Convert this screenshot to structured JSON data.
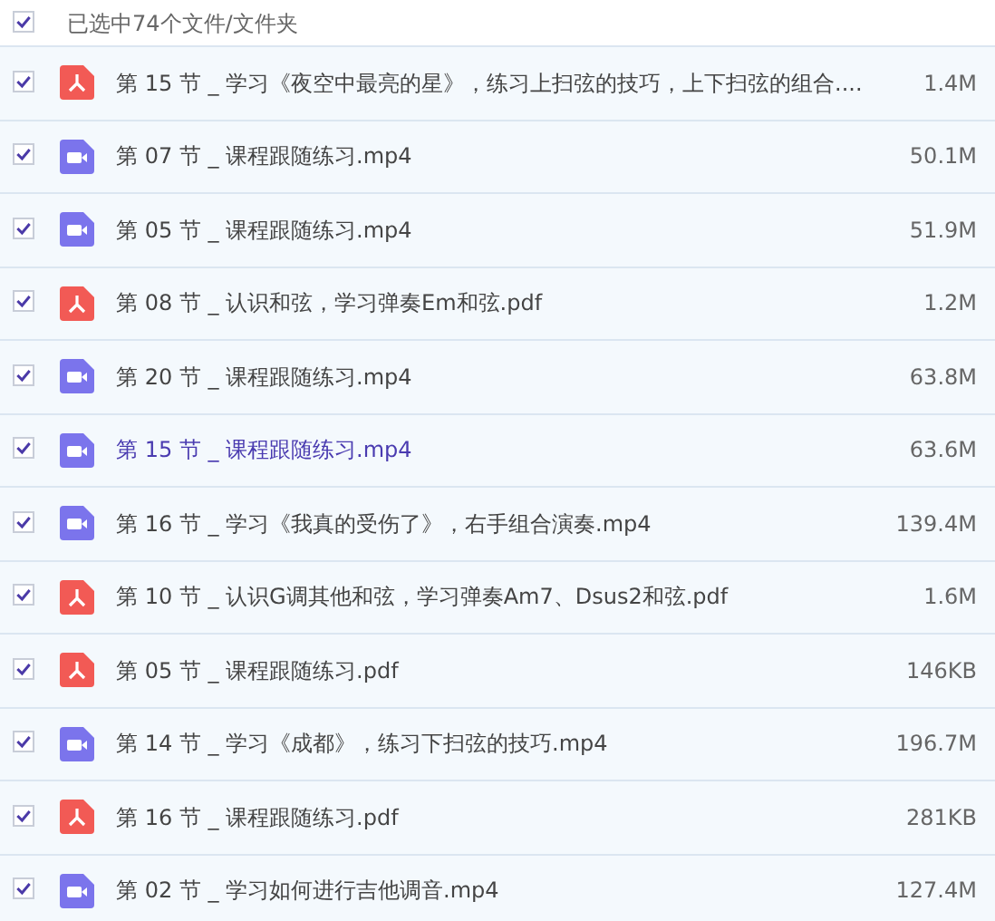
{
  "header": {
    "checked": true,
    "label": "已选中74个文件/文件夹"
  },
  "files": [
    {
      "kind": "pdf",
      "checked": true,
      "highlighted": false,
      "name": "第 15 节 _ 学习《夜空中最亮的星》，练习上扫弦的技巧，上下扫弦的组合....",
      "size": "1.4M"
    },
    {
      "kind": "video",
      "checked": true,
      "highlighted": false,
      "name": "第 07 节 _ 课程跟随练习.mp4",
      "size": "50.1M"
    },
    {
      "kind": "video",
      "checked": true,
      "highlighted": false,
      "name": "第 05 节 _ 课程跟随练习.mp4",
      "size": "51.9M"
    },
    {
      "kind": "pdf",
      "checked": true,
      "highlighted": false,
      "name": "第 08 节 _ 认识和弦，学习弹奏Em和弦.pdf",
      "size": "1.2M"
    },
    {
      "kind": "video",
      "checked": true,
      "highlighted": false,
      "name": "第 20 节 _ 课程跟随练习.mp4",
      "size": "63.8M"
    },
    {
      "kind": "video",
      "checked": true,
      "highlighted": true,
      "name": "第 15 节 _ 课程跟随练习.mp4",
      "size": "63.6M"
    },
    {
      "kind": "video",
      "checked": true,
      "highlighted": false,
      "name": "第 16 节 _ 学习《我真的受伤了》，右手组合演奏.mp4",
      "size": "139.4M"
    },
    {
      "kind": "pdf",
      "checked": true,
      "highlighted": false,
      "name": "第 10 节 _ 认识G调其他和弦，学习弹奏Am7、Dsus2和弦.pdf",
      "size": "1.6M"
    },
    {
      "kind": "pdf",
      "checked": true,
      "highlighted": false,
      "name": "第 05 节 _ 课程跟随练习.pdf",
      "size": "146KB"
    },
    {
      "kind": "video",
      "checked": true,
      "highlighted": false,
      "name": "第 14 节 _ 学习《成都》，练习下扫弦的技巧.mp4",
      "size": "196.7M"
    },
    {
      "kind": "pdf",
      "checked": true,
      "highlighted": false,
      "name": "第 16 节 _ 课程跟随练习.pdf",
      "size": "281KB"
    },
    {
      "kind": "video",
      "checked": true,
      "highlighted": false,
      "name": "第 02 节 _ 学习如何进行吉他调音.mp4",
      "size": "127.4M"
    }
  ]
}
